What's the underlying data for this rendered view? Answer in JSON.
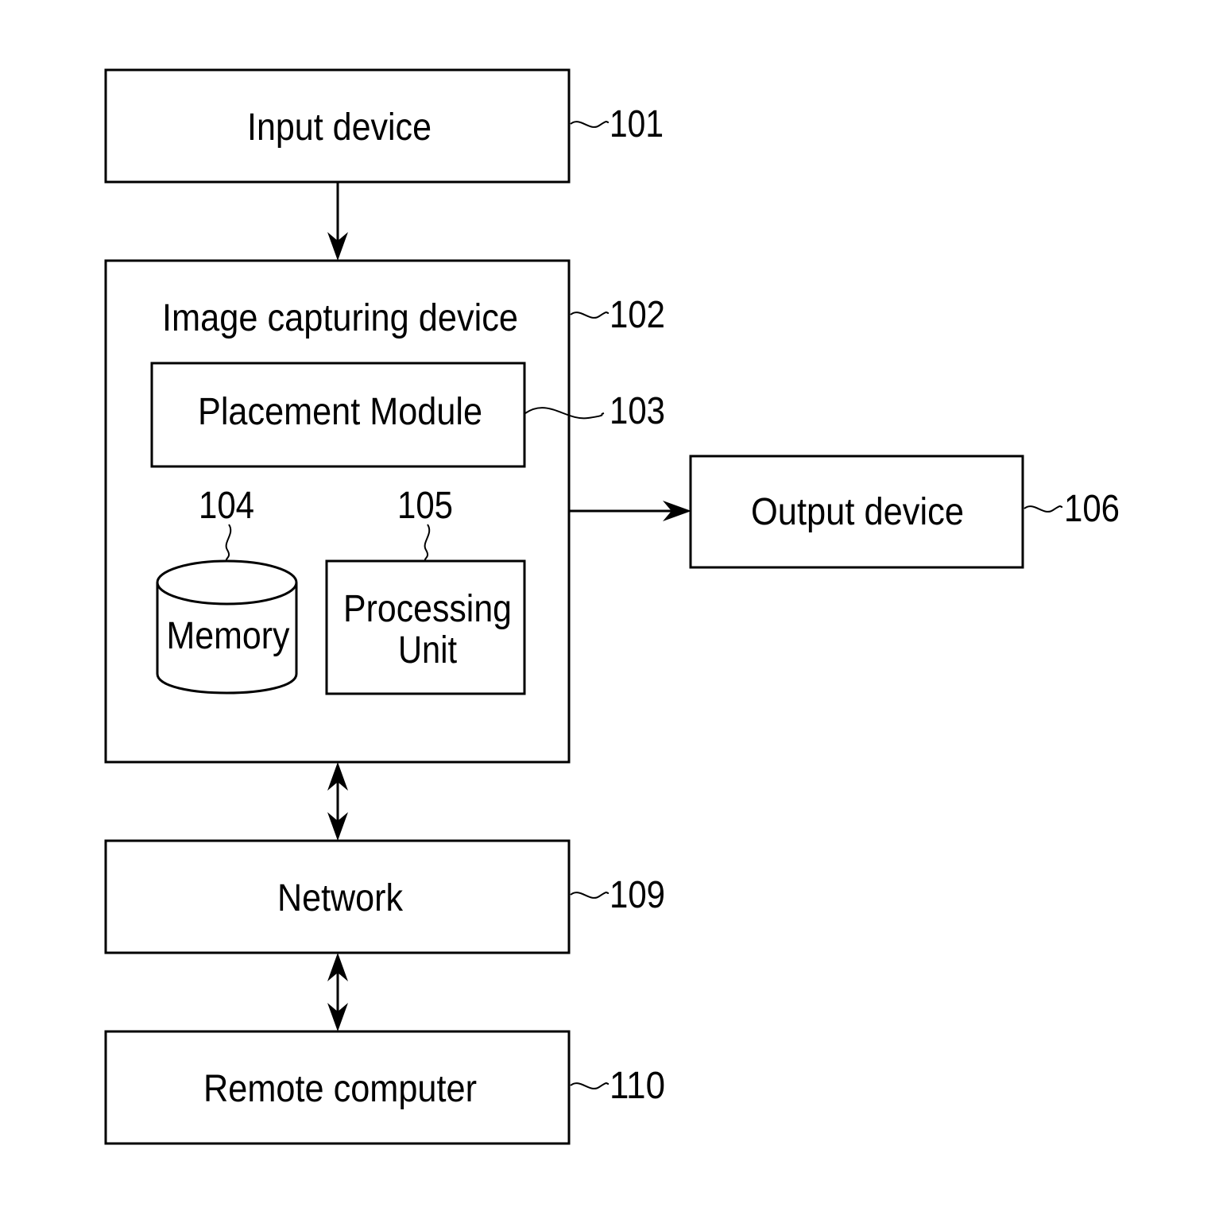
{
  "diagram": {
    "type": "block-diagram",
    "nodes": {
      "input_device": {
        "label": "Input device",
        "ref": "101"
      },
      "image_capturing_device": {
        "label": "Image capturing device",
        "ref": "102"
      },
      "placement_module": {
        "label": "Placement Module",
        "ref": "103"
      },
      "memory": {
        "label": "Memory",
        "ref": "104",
        "shape": "cylinder"
      },
      "processing_unit": {
        "label_line1": "Processing",
        "label_line2": "Unit",
        "ref": "105"
      },
      "output_device": {
        "label": "Output device",
        "ref": "106"
      },
      "network": {
        "label": "Network",
        "ref": "109"
      },
      "remote_computer": {
        "label": "Remote computer",
        "ref": "110"
      }
    },
    "edges": [
      {
        "from": "Input device",
        "to": "Image capturing device",
        "direction": "one-way"
      },
      {
        "from": "Image capturing device",
        "to": "Output device",
        "direction": "one-way"
      },
      {
        "from": "Image capturing device",
        "to": "Network",
        "direction": "two-way"
      },
      {
        "from": "Network",
        "to": "Remote computer",
        "direction": "two-way"
      }
    ]
  }
}
